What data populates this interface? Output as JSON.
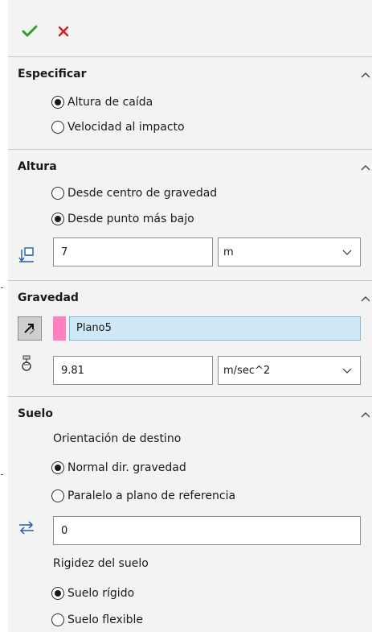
{
  "toolbar": {
    "ok_icon": "check-icon",
    "cancel_icon": "close-icon"
  },
  "sections": {
    "especificar": {
      "title": "Especificar",
      "options": [
        "Altura de caída",
        "Velocidad al impacto"
      ],
      "selected_index": 0
    },
    "altura": {
      "title": "Altura",
      "options": [
        "Desde centro de gravedad",
        "Desde punto más bajo"
      ],
      "selected_index": 1,
      "value": "7",
      "unit": "m",
      "icon": "height-icon"
    },
    "gravedad": {
      "title": "Gravedad",
      "reference": "Plano5",
      "reference_color": "#ff80c0",
      "value": "9.81",
      "unit": "m/sec^2",
      "direction_icon": "reverse-direction-icon",
      "icon": "gravity-icon"
    },
    "suelo": {
      "title": "Suelo",
      "orientation_label": "Orientación de destino",
      "orientation_options": [
        "Normal dir. gravedad",
        "Paralelo a plano de referencia"
      ],
      "orientation_selected": 0,
      "offset_value": "0",
      "offset_icon": "offset-icon",
      "rigidity_label": "Rigidez del suelo",
      "rigidity_options": [
        "Suelo rígido",
        "Suelo flexible"
      ],
      "rigidity_selected": 0
    }
  },
  "colors": {
    "panel_bg": "#f3f3f3",
    "ok_green": "#2e9e2e",
    "cancel_red": "#d92020",
    "selection_bg": "#cfe8f7"
  }
}
